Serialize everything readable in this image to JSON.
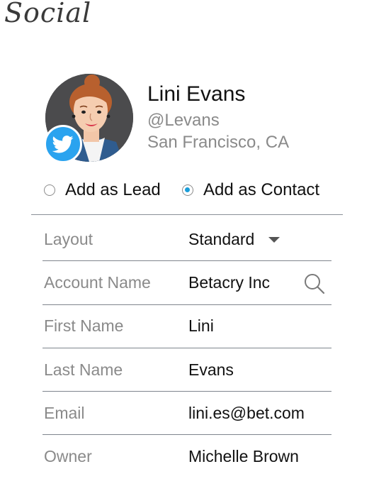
{
  "page": {
    "heading": "Social"
  },
  "profile": {
    "name": "Lini Evans",
    "handle": "@Levans",
    "location": "San Francisco, CA",
    "network_icon": "twitter-icon",
    "network_color": "#2aa3ef"
  },
  "import_as": {
    "options": [
      {
        "label": "Add as Lead",
        "selected": false
      },
      {
        "label": "Add as Contact",
        "selected": true
      }
    ],
    "accent_color": "#1a9ed9"
  },
  "form": {
    "fields": [
      {
        "label": "Layout",
        "value": "Standard",
        "control": "dropdown"
      },
      {
        "label": "Account Name",
        "value": "Betacry Inc",
        "control": "lookup"
      },
      {
        "label": "First Name",
        "value": "Lini",
        "control": "text"
      },
      {
        "label": "Last Name",
        "value": "Evans",
        "control": "text"
      },
      {
        "label": "Email",
        "value": "lini.es@bet.com",
        "control": "text"
      },
      {
        "label": "Owner",
        "value": "Michelle Brown",
        "control": "text"
      }
    ]
  }
}
